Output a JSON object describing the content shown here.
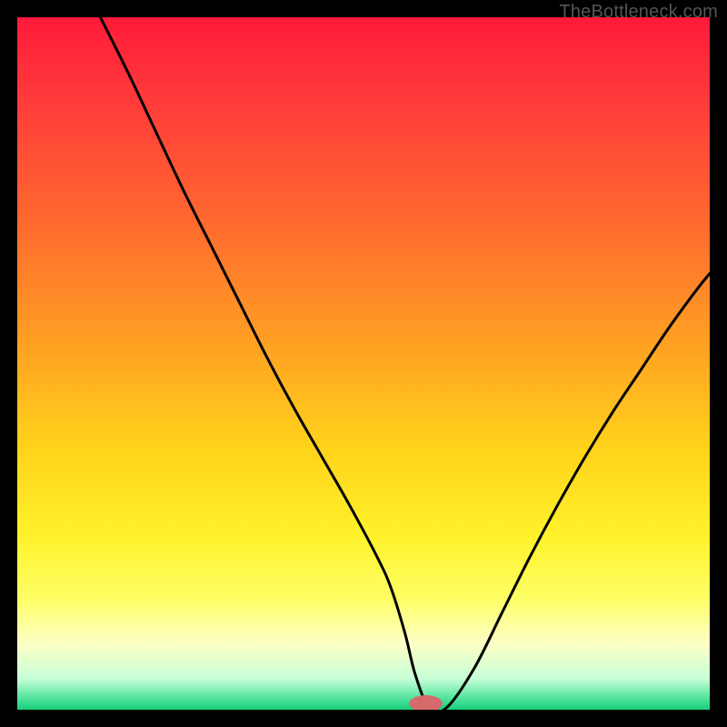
{
  "watermark": "TheBottleneck.com",
  "colors": {
    "frame": "#000000",
    "watermark": "#555555",
    "curve": "#000000",
    "marker_fill": "#d46a6a",
    "gradient_stops": [
      {
        "offset": 0.0,
        "color": "#ff1a3a"
      },
      {
        "offset": 0.12,
        "color": "#ff3b3b"
      },
      {
        "offset": 0.3,
        "color": "#ff6a2e"
      },
      {
        "offset": 0.48,
        "color": "#ffa322"
      },
      {
        "offset": 0.62,
        "color": "#ffd21a"
      },
      {
        "offset": 0.75,
        "color": "#fff22a"
      },
      {
        "offset": 0.84,
        "color": "#feff66"
      },
      {
        "offset": 0.905,
        "color": "#fcffc5"
      },
      {
        "offset": 0.955,
        "color": "#c8ffd8"
      },
      {
        "offset": 0.985,
        "color": "#4be29a"
      },
      {
        "offset": 1.0,
        "color": "#17d07a"
      }
    ]
  },
  "chart_data": {
    "type": "line",
    "title": "",
    "xlabel": "",
    "ylabel": "",
    "xlim": [
      0,
      100
    ],
    "ylim": [
      0,
      100
    ],
    "x": [
      12,
      16,
      20,
      24,
      28,
      32,
      36,
      40,
      44,
      48,
      52,
      54,
      56,
      57.5,
      59.5,
      62,
      66,
      70,
      74,
      78,
      82,
      86,
      90,
      94,
      98,
      100
    ],
    "values": [
      100,
      92,
      83.5,
      75,
      67,
      59,
      51,
      43.5,
      36.5,
      29.5,
      22,
      17.5,
      11,
      5,
      0.3,
      0.3,
      6,
      14,
      22,
      29.5,
      36.5,
      43,
      49,
      55,
      60.5,
      63
    ],
    "marker": {
      "x": 59,
      "y": 0.9,
      "rx": 2.4,
      "ry": 1.2
    },
    "notes": "V-shaped bottleneck curve; x is a relative balance axis (0-100), y is bottleneck percentage (0-100). Minimum at x≈59 where left branch meets baseline; short flat segment then right branch rises."
  }
}
